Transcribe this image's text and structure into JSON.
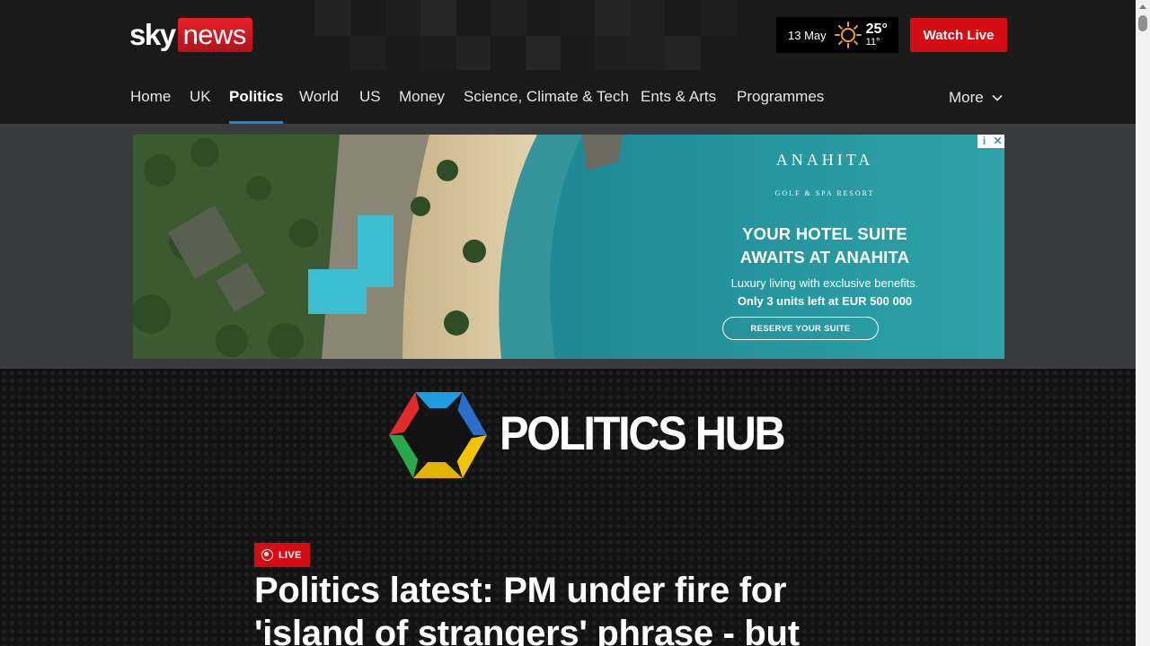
{
  "header": {
    "logo": {
      "sky": "sky",
      "news": "news"
    },
    "weather": {
      "date": "13 May",
      "high": "25°",
      "low": "11°",
      "icon": "sun-icon"
    },
    "watch_live": "Watch Live"
  },
  "nav": {
    "items": [
      {
        "label": "Home"
      },
      {
        "label": "UK"
      },
      {
        "label": "Politics",
        "active": true
      },
      {
        "label": "World"
      },
      {
        "label": "US"
      },
      {
        "label": "Money"
      },
      {
        "label": "Science, Climate & Tech"
      },
      {
        "label": "Ents & Arts"
      },
      {
        "label": "Programmes"
      }
    ],
    "more": "More",
    "active_color": "#1e88d2"
  },
  "ad": {
    "brand": "ANAHITA",
    "subbrand": "GOLF & SPA RESORT",
    "headline_1": "YOUR HOTEL SUITE",
    "headline_2": "AWAITS AT ANAHITA",
    "body_1": "Luxury living with exclusive benefits.",
    "body_2": "Only 3 units left at EUR 500 000",
    "cta": "RESERVE YOUR SUITE"
  },
  "hub": {
    "title": "POLITICS HUB",
    "live_label": "LIVE",
    "headline": "Politics latest: PM under fire for 'island of strangers' phrase - but"
  },
  "colors": {
    "brand_red": "#d50c14",
    "header_bg": "#1a1a1a",
    "ad_band_bg": "#3a3b3e"
  }
}
